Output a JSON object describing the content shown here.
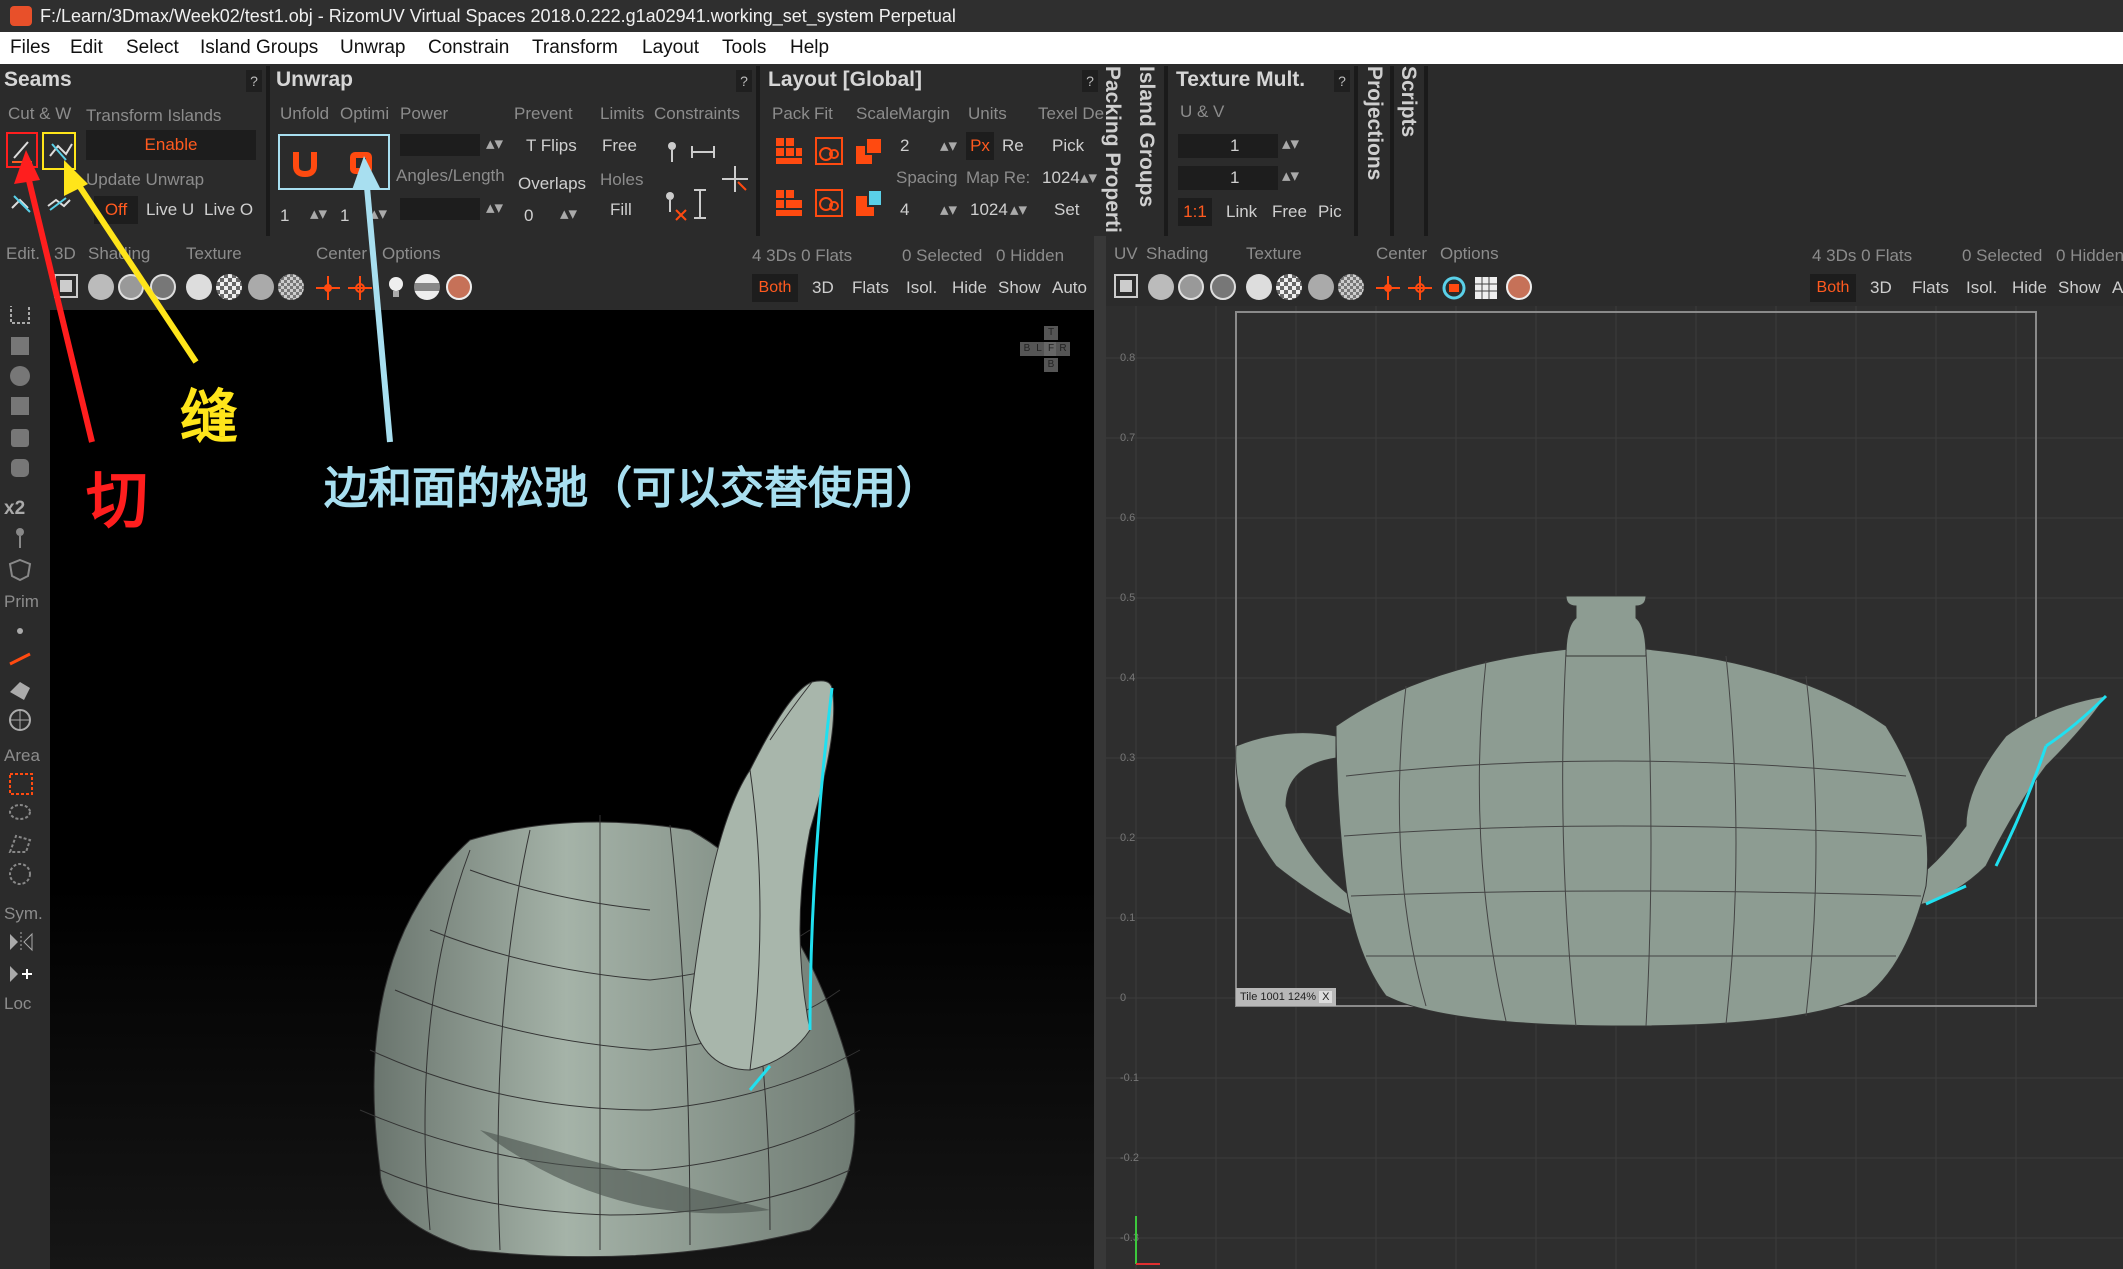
{
  "window": {
    "title": "F:/Learn/3Dmax/Week02/test1.obj - RizomUV  Virtual Spaces 2018.0.222.g1a02941.working_set_system Perpetual"
  },
  "menu": [
    "Files",
    "Edit",
    "Select",
    "Island Groups",
    "Unwrap",
    "Constrain",
    "Transform",
    "Layout",
    "Tools",
    "Help"
  ],
  "seams": {
    "title": "Seams",
    "help": "?",
    "cut_weld": "Cut & W",
    "transform_islands": "Transform Islands",
    "enable": "Enable",
    "update_unwrap": "Update Unwrap",
    "off": "Off",
    "live_u": "Live U",
    "live_o": "Live O"
  },
  "unwrap": {
    "title": "Unwrap",
    "help": "?",
    "unfold": "Unfold",
    "optimize": "Optimi",
    "power": "Power",
    "prevent": "Prevent",
    "t_flips": "T Flips",
    "overlaps": "Overlaps",
    "angles_length": "Angles/Length",
    "limits": "Limits",
    "free": "Free",
    "holes": "Holes",
    "fill": "Fill",
    "constraints": "Constraints",
    "unfold_iter": "1",
    "optimize_iter": "1",
    "overlaps_val": "0"
  },
  "layout": {
    "title": "Layout [Global]",
    "help": "?",
    "pack": "Pack",
    "fit": "Fit",
    "scale": "Scale",
    "margin": "Margin",
    "margin_val": "2",
    "spacing": "Spacing",
    "spacing_val": "4",
    "units": "Units",
    "px": "Px",
    "re": "Re",
    "map_res": "Map Re:",
    "map_res_val": "1024",
    "texel_density": "Texel De",
    "pick": "Pick",
    "texel_val": "1024",
    "set": "Set"
  },
  "side_tabs": {
    "packing": "Packing Properti",
    "island_groups": "Island Groups",
    "projections": "Projections",
    "scripts": "Scripts"
  },
  "texture_mult": {
    "title": "Texture Mult.",
    "help": "?",
    "u_v": "U & V",
    "u_val": "1",
    "v_val": "1",
    "ratio": "1:1",
    "link": "Link",
    "free": "Free",
    "pick": "Pic"
  },
  "viewport3d": {
    "tabs": [
      "Edit.",
      "3D",
      "Shading",
      "Texture",
      "Center",
      "Options"
    ],
    "stats": "4 3Ds 0 Flats",
    "selected": "0 Selected",
    "hidden": "0 Hidden",
    "toggles": [
      "Both",
      "3D",
      "Flats",
      "Isol.",
      "Hide",
      "Show",
      "Auto"
    ],
    "cube_labels": [
      "T",
      "B",
      "L",
      "F",
      "R",
      "B"
    ]
  },
  "viewportuv": {
    "tabs": [
      "UV",
      "Shading",
      "Texture",
      "Center",
      "Options"
    ],
    "stats": "4 3Ds 0 Flats",
    "selected": "0 Selected",
    "hidden": "0 Hidden",
    "toggles": [
      "Both",
      "3D",
      "Flats",
      "Isol.",
      "Hide",
      "Show",
      "A"
    ],
    "tile_label": "Tile 1001 124%",
    "tile_close": "X",
    "axis": [
      "0.8",
      "0.7",
      "0.6",
      "0.5",
      "0.4",
      "0.3",
      "0.2",
      "0.1",
      "0",
      "-0.1",
      "-0.2",
      "-0.3"
    ]
  },
  "left_toolbar": {
    "labels": [
      "Prim",
      "Area",
      "Sym.",
      "Loc"
    ],
    "x2": "x2"
  },
  "annotations": {
    "cut": "切",
    "seam": "缝",
    "relax": "边和面的松弛（可以交替使用）"
  },
  "colors": {
    "accent": "#ff5a1f",
    "red_annot": "#ff1e1e",
    "yellow_annot": "#ffe51a",
    "blue_annot": "#a8dff0",
    "seam_cyan": "#20e0f0",
    "mesh": "#8e9e93"
  }
}
